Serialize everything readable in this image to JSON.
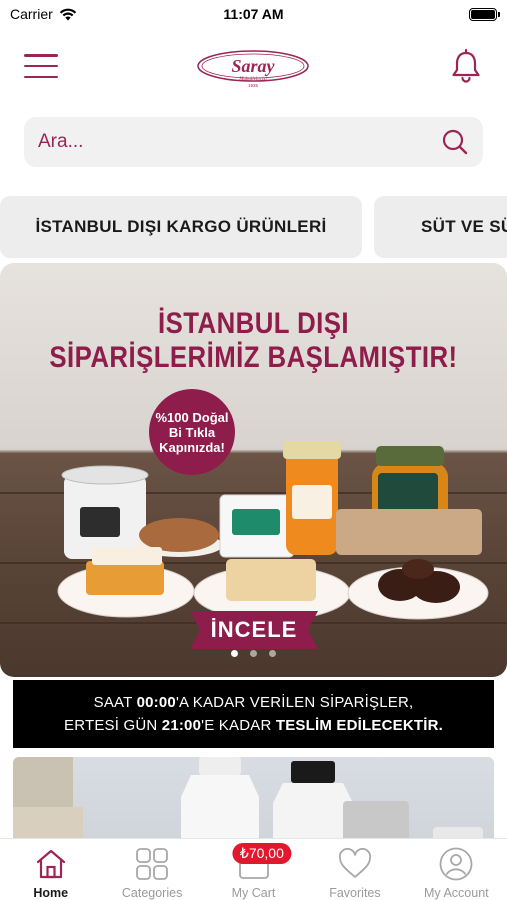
{
  "status_bar": {
    "carrier": "Carrier",
    "time": "11:07 AM"
  },
  "header": {
    "menu_icon": "hamburger-menu-icon",
    "logo_text": "Saray",
    "logo_subtext": "Muhallebicisi",
    "logo_year": "1935",
    "notification_icon": "bell-icon",
    "brand_color": "#9b2555"
  },
  "search": {
    "placeholder": "Ara...",
    "icon": "search-icon"
  },
  "categories": [
    {
      "label": "İSTANBUL DIŞI KARGO ÜRÜNLERİ"
    },
    {
      "label": "SÜT VE SÜ"
    }
  ],
  "banner": {
    "title_line1": "İSTANBUL DIŞI",
    "title_line2": "SİPARİŞLERİMİZ BAŞLAMIŞTIR!",
    "badge_line1": "%100 Doğal",
    "badge_line2": "Bi Tıkla",
    "badge_line3": "Kapınızda!",
    "cta": "İNCELE",
    "slide_count": 3,
    "active_slide": 1
  },
  "notice": {
    "line1_pre": "SAAT ",
    "line1_bold": "00:00",
    "line1_post": "'A KADAR VERİLEN SİPARİŞLER,",
    "line2_pre": "ERTESİ GÜN ",
    "line2_bold1": "21:00",
    "line2_mid": "'E KADAR ",
    "line2_bold2": "TESLİM EDİLECEKTİR."
  },
  "tabbar": {
    "active_color": "#9b2555",
    "cart_badge": "₺70,00",
    "tabs": [
      {
        "label": "Home",
        "icon": "home-icon",
        "active": true
      },
      {
        "label": "Categories",
        "icon": "grid-icon",
        "active": false
      },
      {
        "label": "My Cart",
        "icon": "cart-icon",
        "active": false
      },
      {
        "label": "Favorites",
        "icon": "heart-icon",
        "active": false
      },
      {
        "label": "My Account",
        "icon": "user-icon",
        "active": false
      }
    ]
  }
}
